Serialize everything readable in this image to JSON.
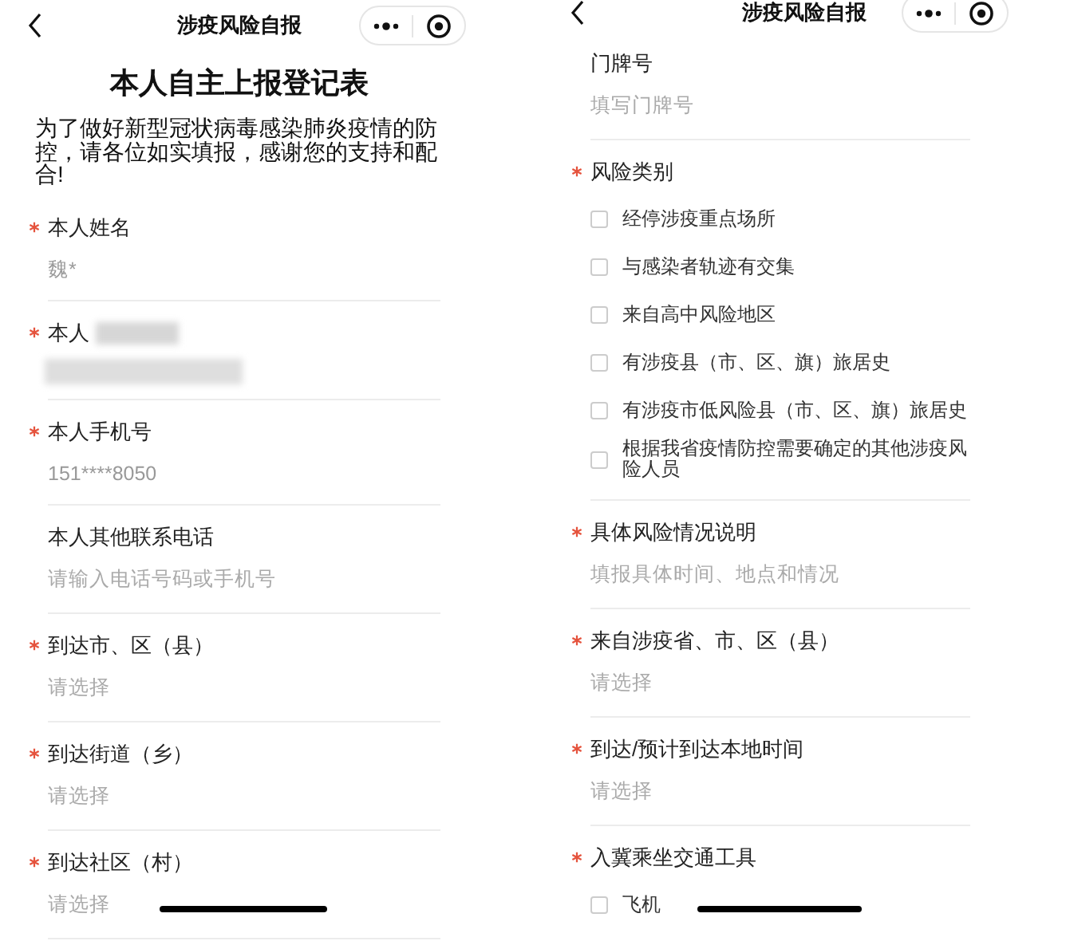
{
  "screens": [
    {
      "nav": {
        "title": "涉疫风险自报"
      },
      "form_title": "本人自主上报登记表",
      "intro": "为了做好新型冠状病毒感染肺炎疫情的防控，请各位如实填报，感谢您的支持和配合!",
      "fields": [
        {
          "kind": "text",
          "label": "本人姓名",
          "required": true,
          "value": "魏*"
        },
        {
          "kind": "redacted",
          "label": "本人",
          "required": true
        },
        {
          "kind": "text",
          "label": "本人手机号",
          "required": true,
          "value": "151****8050"
        },
        {
          "kind": "text",
          "label": "本人其他联系电话",
          "required": false,
          "placeholder": "请输入电话号码或手机号"
        },
        {
          "kind": "text",
          "label": "到达市、区（县）",
          "required": true,
          "placeholder": "请选择"
        },
        {
          "kind": "text",
          "label": "到达街道（乡）",
          "required": true,
          "placeholder": "请选择"
        },
        {
          "kind": "text",
          "label": "到达社区（村）",
          "required": true,
          "placeholder": "请选择"
        }
      ]
    },
    {
      "nav": {
        "title": "涉疫风险自报"
      },
      "fields": [
        {
          "kind": "text",
          "label": "门牌号",
          "required": false,
          "placeholder": "填写门牌号"
        },
        {
          "kind": "checkboxes",
          "label": "风险类别",
          "required": true,
          "options": [
            {
              "label": "经停涉疫重点场所",
              "checked": false
            },
            {
              "label": "与感染者轨迹有交集",
              "checked": false
            },
            {
              "label": "来自高中风险地区",
              "checked": false
            },
            {
              "label": "有涉疫县（市、区、旗）旅居史",
              "checked": false
            },
            {
              "label": "有涉疫市低风险县（市、区、旗）旅居史",
              "checked": false
            },
            {
              "label": "根据我省疫情防控需要确定的其他涉疫风险人员",
              "checked": false
            }
          ]
        },
        {
          "kind": "text",
          "label": "具体风险情况说明",
          "required": true,
          "placeholder": "填报具体时间、地点和情况"
        },
        {
          "kind": "text",
          "label": "来自涉疫省、市、区（县）",
          "required": true,
          "placeholder": "请选择"
        },
        {
          "kind": "text",
          "label": "到达/预计到达本地时间",
          "required": true,
          "placeholder": "请选择"
        },
        {
          "kind": "checkboxes",
          "label": "入冀乘坐交通工具",
          "required": true,
          "options": [
            {
              "label": "飞机",
              "checked": false
            }
          ]
        }
      ]
    }
  ]
}
